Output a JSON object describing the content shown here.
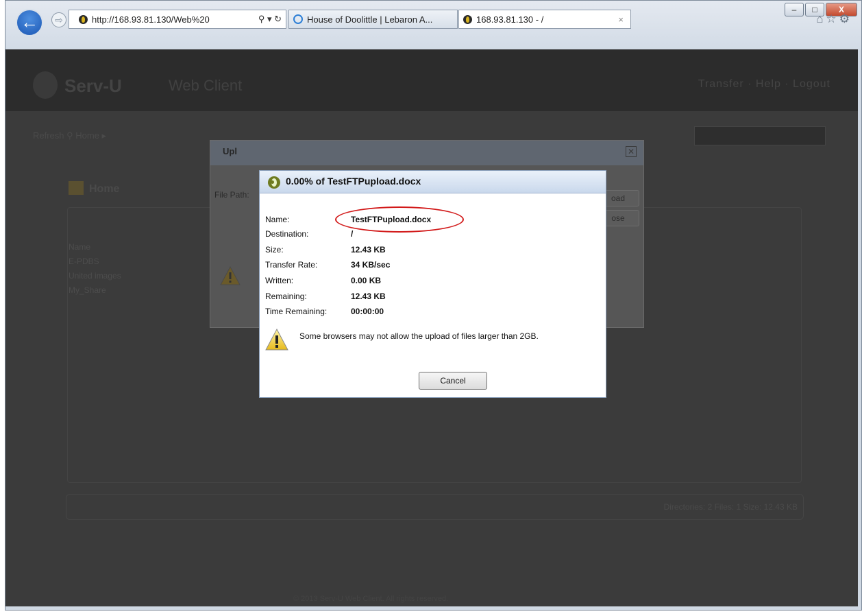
{
  "browser": {
    "address_url": "http://168.93.81.130/Web%20",
    "address_icons": "⚲ ▾ ↻",
    "tabs": [
      {
        "title": "House of Doolittle | Lebaron A..."
      },
      {
        "title": "168.93.81.130 - /",
        "close": "×"
      }
    ],
    "window_controls": {
      "minimize": "–",
      "maximize": "□",
      "close": "X"
    },
    "toolbar_icons": [
      "home-icon",
      "star-icon",
      "gear-icon"
    ]
  },
  "background_page": {
    "logo": "Serv-U",
    "logo_sub": "Web Client",
    "header_right": "Transfer  ·  Help  ·  Logout",
    "toolbar": "Refresh  ⚲  Home ▸",
    "home_label": "Home",
    "list_items": [
      "Name",
      "E-PDBS",
      "United images",
      "My_Share"
    ],
    "status": "Directories: 2   Files: 1   Size: 12.43 KB",
    "footer": "© 2013 Serv-U Web Client. All rights reserved."
  },
  "upload_dialog": {
    "title": "Upl",
    "file_path_label": "File Path:",
    "upload_button": "oad",
    "close_button": "ose"
  },
  "progress_dialog": {
    "title": "0.00% of TestFTPupload.docx",
    "fields": [
      {
        "label": "Name:",
        "value": "TestFTPupload.docx"
      },
      {
        "label": "Destination:",
        "value": "/"
      },
      {
        "label": "Size:",
        "value": "12.43 KB"
      },
      {
        "label": "Transfer Rate:",
        "value": "34 KB/sec"
      },
      {
        "label": "Written:",
        "value": "0.00 KB"
      },
      {
        "label": "Remaining:",
        "value": "12.43 KB"
      },
      {
        "label": "Time Remaining:",
        "value": "00:00:00"
      }
    ],
    "warning": "Some browsers may not allow the upload of files larger than 2GB.",
    "cancel_label": "Cancel"
  },
  "colors": {
    "annotation_circle": "#d21a1a",
    "dialog_title_bg": "#c9d8ec",
    "page_overlay": "#3b3b3b"
  }
}
